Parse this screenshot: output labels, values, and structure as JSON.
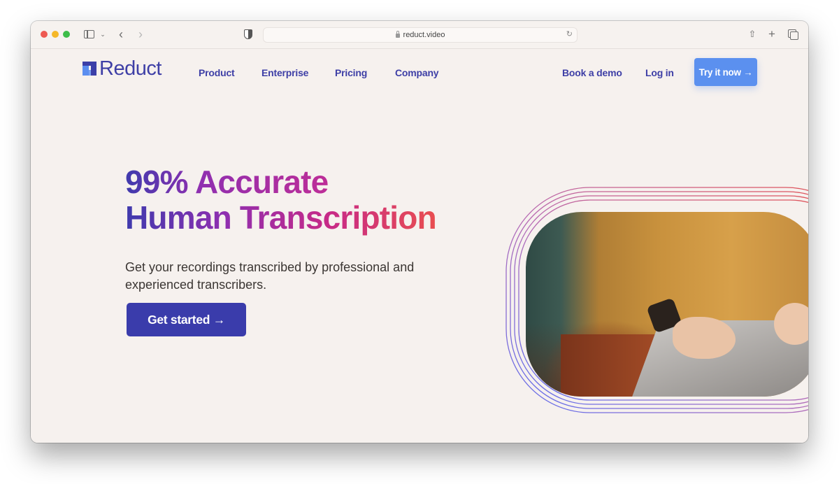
{
  "browser": {
    "url": "reduct.video",
    "controls": {
      "close": "close-window",
      "minimize": "minimize-window",
      "zoom": "zoom-window"
    },
    "icons": {
      "sidebar": "sidebar-icon",
      "back": "‹",
      "forward": "›",
      "chevron_down": "⌄",
      "reload": "↻",
      "share": "⇧",
      "new_tab": "+"
    },
    "colors": {
      "close": "#ee5a52",
      "minimize": "#f5b829",
      "zoom": "#3dbd49"
    }
  },
  "header": {
    "logo_text": "Reduct",
    "nav": [
      {
        "label": "Product"
      },
      {
        "label": "Enterprise"
      },
      {
        "label": "Pricing"
      },
      {
        "label": "Company"
      }
    ],
    "book_demo": "Book a demo",
    "login": "Log in",
    "try_now": "Try it now →"
  },
  "hero": {
    "headline_line1": "99% Accurate",
    "headline_line2": "Human Transcription",
    "subtext": "Get your recordings transcribed by professional and experienced transcribers.",
    "cta": "Get started →",
    "image_alt": "Person in a mustard sweater typing on a laptop"
  },
  "colors": {
    "brand_primary": "#3e3fa6",
    "button_blue": "#5b90ef",
    "cta_indigo": "#3a3cab",
    "page_background": "#f6f1ee",
    "gradient_start": "#3f3aad",
    "gradient_mid": "#c82a86",
    "gradient_end": "#ef5545"
  }
}
